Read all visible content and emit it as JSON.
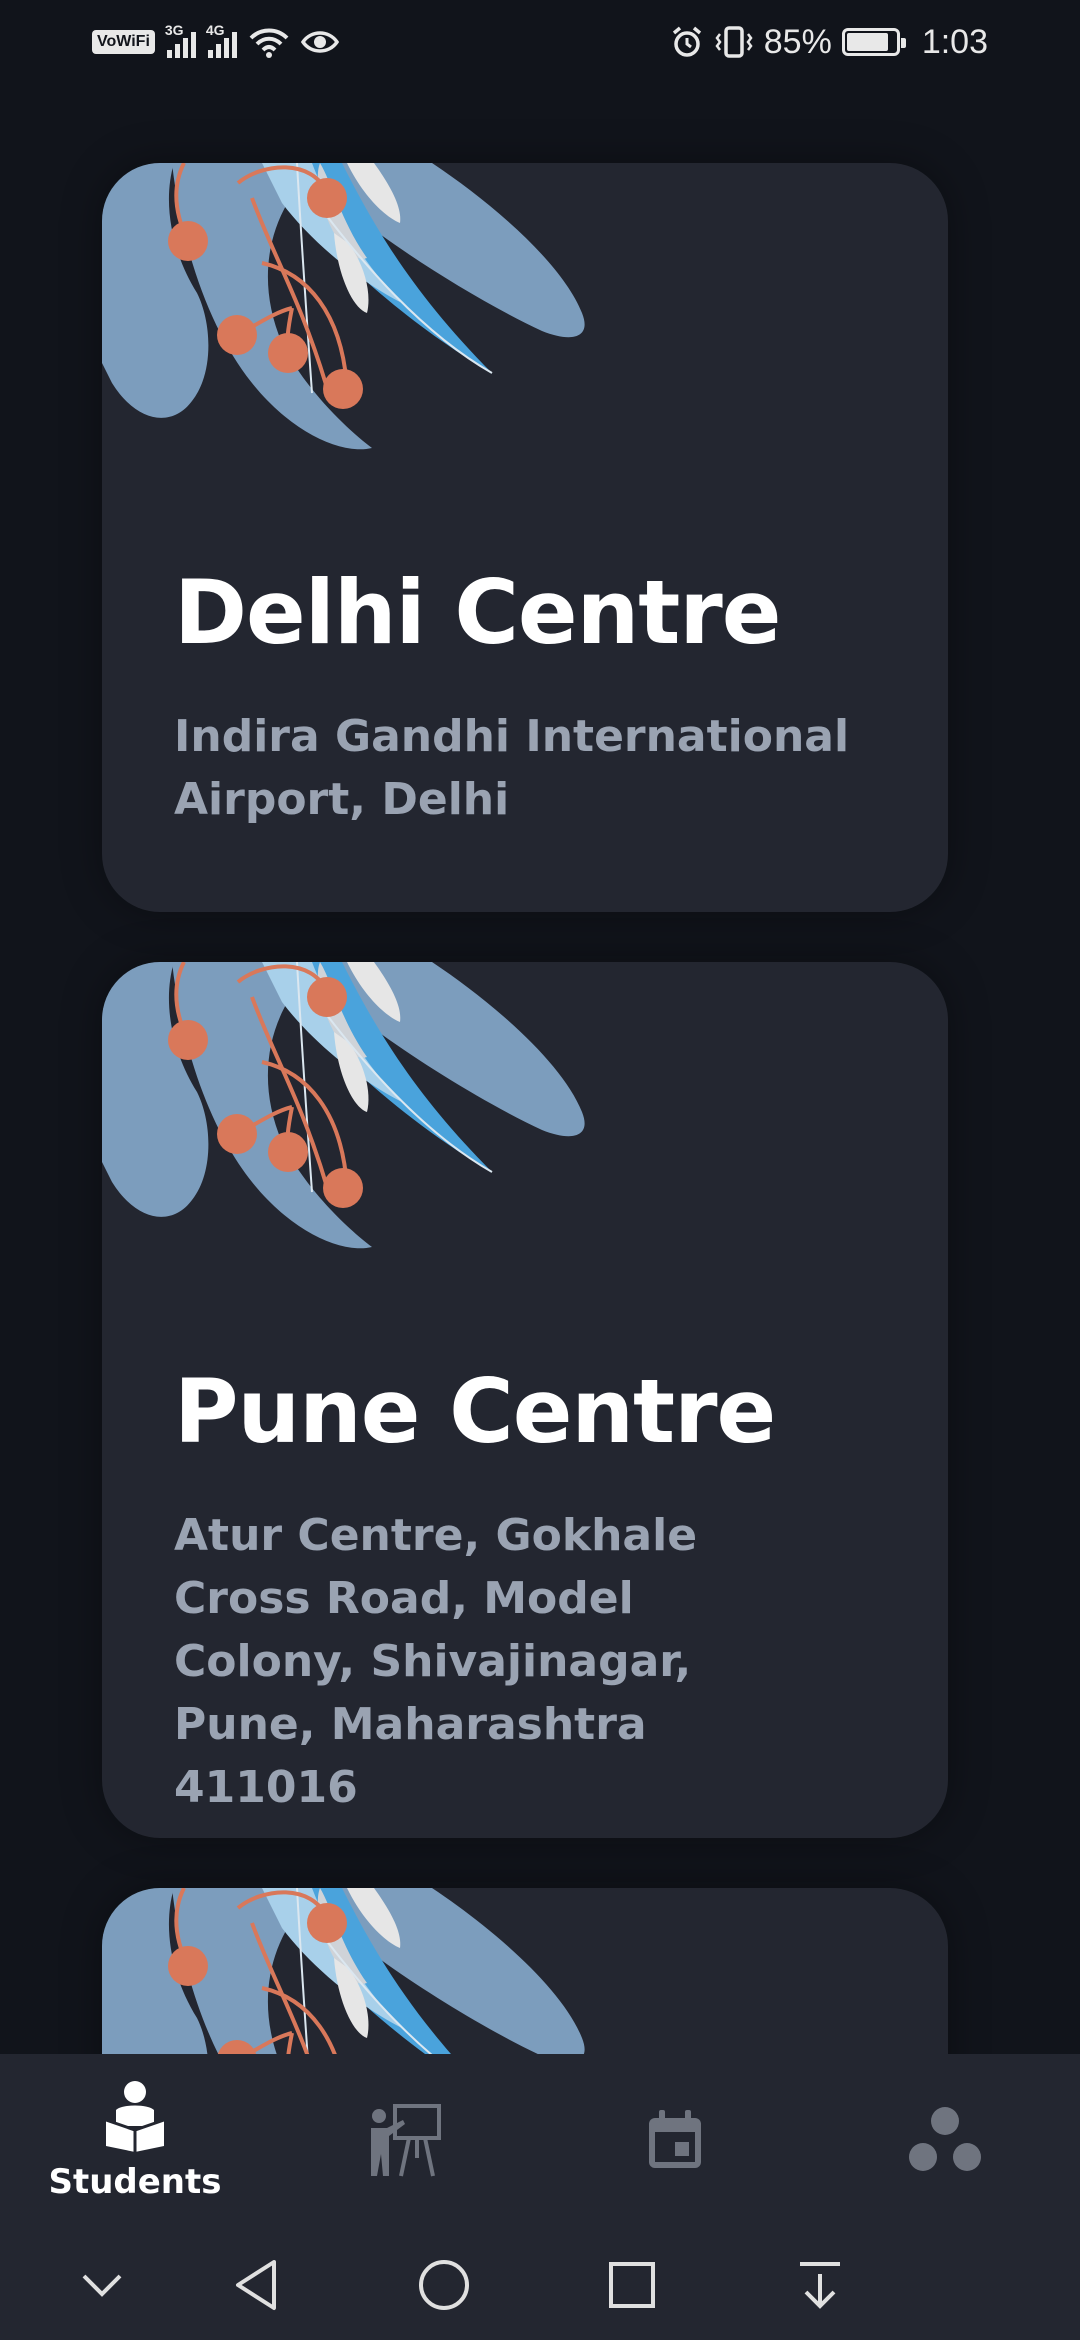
{
  "status_bar": {
    "vowifi": "VoWiFi",
    "sim1_tag": "3G",
    "sim2_tag": "4G",
    "battery_percent": "85%",
    "battery_level": 0.85,
    "time": "1:03"
  },
  "centres": [
    {
      "name": "Delhi Centre",
      "address": "Indira Gandhi International Airport, Delhi"
    },
    {
      "name": "Pune Centre",
      "address": "Atur Centre, Gokhale Cross Road, Model Colony, Shivajinagar, Pune, Maharashtra 411016"
    }
  ],
  "bottom_nav": {
    "items": [
      {
        "label": "Students",
        "icon": "student-reading-icon",
        "active": true
      },
      {
        "label": "",
        "icon": "teacher-board-icon",
        "active": false
      },
      {
        "label": "",
        "icon": "calendar-icon",
        "active": false
      },
      {
        "label": "",
        "icon": "three-dots-icon",
        "active": false
      }
    ]
  },
  "system_nav": {
    "items": [
      "chevron-down-icon",
      "back-icon",
      "home-icon",
      "recents-icon",
      "download-icon"
    ]
  },
  "colors": {
    "background": "#11141b",
    "card": "#232630",
    "address_text": "#9aa3b2",
    "accent_orange": "#d9785a",
    "leaf_blue": "#7c9dbd",
    "leaf_bright": "#4aa3dc"
  }
}
